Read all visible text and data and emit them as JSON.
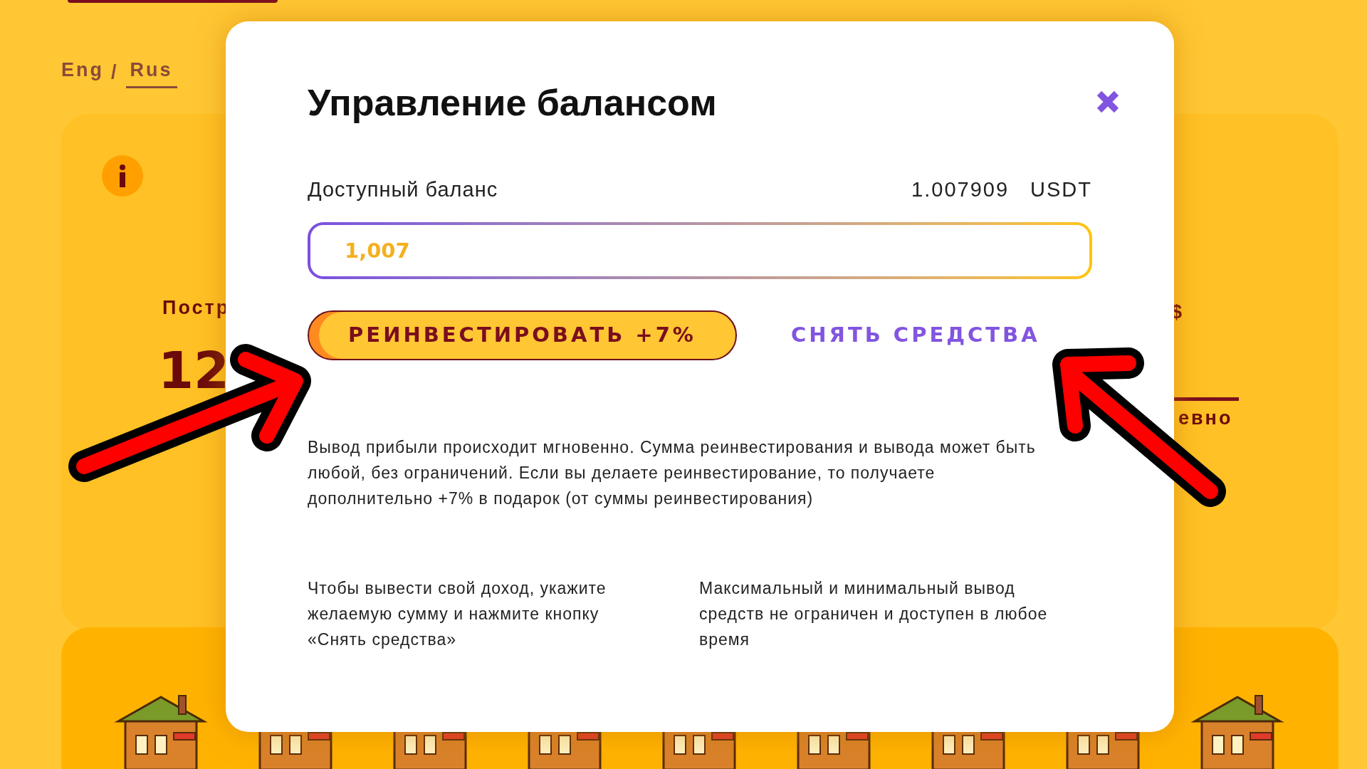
{
  "background": {
    "languages": [
      {
        "label": "Eng",
        "selected": false
      },
      {
        "label": "Rus",
        "selected": true
      }
    ],
    "separator": "/",
    "stat_label": "Постр",
    "stat_value": "12",
    "right_label": "$",
    "right_caption": "евно"
  },
  "modal": {
    "title": "Управление балансом",
    "balance_label": "Доступный баланс",
    "balance_value": "1.007909",
    "currency": "USDT",
    "amount_value": "1,007",
    "reinvest_button": "РЕИНВЕСТИРОВАТЬ +7%",
    "withdraw_button": "СНЯТЬ СРЕДСТВА",
    "description": "Вывод прибыли происходит мгновенно. Сумма реинвестирования и вывода может быть любой, без ограничений. Если вы делаете реинвестирование, то получаете дополнительно +7% в подарок (от суммы реинвестирования)",
    "notes": [
      "Чтобы вывести свой доход, укажите желаемую сумму и нажмите кнопку «Снять средства»",
      "Максимальный и минимальный вывод средств не ограничен и доступен в любое время"
    ]
  }
}
